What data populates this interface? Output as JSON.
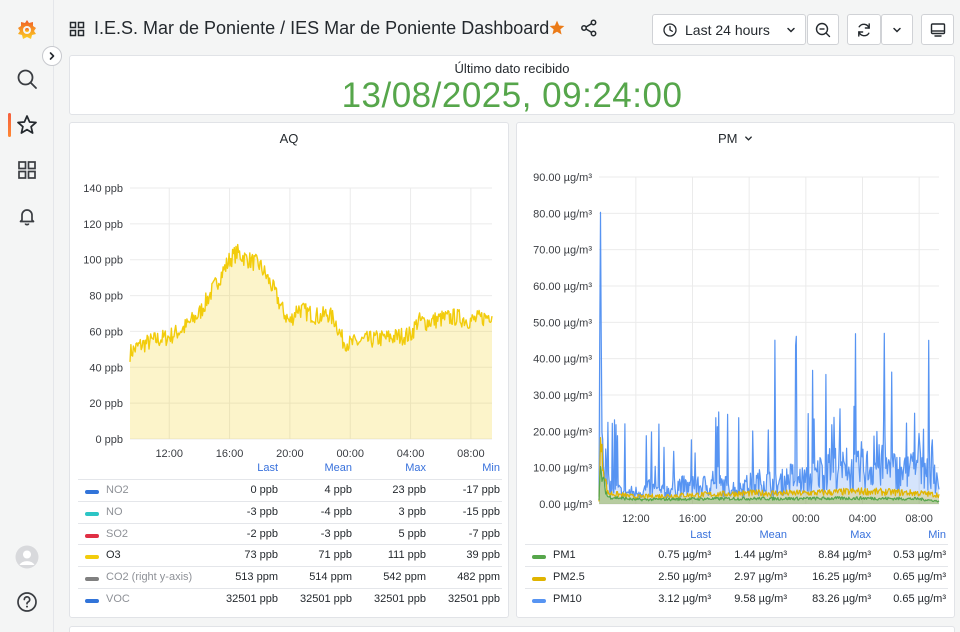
{
  "header": {
    "breadcrumb": "I.E.S. Mar de Poniente  / IES Mar de Poniente Dashboard",
    "time_range": "Last 24 hours"
  },
  "stat": {
    "label": "Último dato recibido",
    "value": "13/08/2025, 09:24:00",
    "color": "#56a64b"
  },
  "aq": {
    "title": "AQ",
    "legend_headers": [
      "Last",
      "Mean",
      "Max",
      "Min"
    ],
    "rows": [
      {
        "name": "NO2",
        "color": "#3274d9",
        "last": "0 ppb",
        "mean": "4 ppb",
        "max": "23 ppb",
        "min": "-17 ppb",
        "hidden": true
      },
      {
        "name": "NO",
        "color": "#2cc5c5",
        "last": "-3 ppb",
        "mean": "-4 ppb",
        "max": "3 ppb",
        "min": "-15 ppb",
        "hidden": true
      },
      {
        "name": "SO2",
        "color": "#e02f44",
        "last": "-2 ppb",
        "mean": "-3 ppb",
        "max": "5 ppb",
        "min": "-7 ppb",
        "hidden": true
      },
      {
        "name": "O3",
        "color": "#f2cc0c",
        "last": "73 ppb",
        "mean": "71 ppb",
        "max": "111 ppb",
        "min": "39 ppb",
        "hidden": false
      },
      {
        "name": "CO2 (right y-axis)",
        "color": "#808080",
        "last": "513 ppm",
        "mean": "514 ppm",
        "max": "542 ppm",
        "min": "482 ppm",
        "hidden": true
      },
      {
        "name": "VOC",
        "color": "#3274d9",
        "last": "32501 ppb",
        "mean": "32501 ppb",
        "max": "32501 ppb",
        "min": "32501 ppb",
        "hidden": true
      }
    ]
  },
  "pm": {
    "title": "PM",
    "legend_headers": [
      "Last",
      "Mean",
      "Max",
      "Min"
    ],
    "rows": [
      {
        "name": "PM1",
        "color": "#56a64b",
        "last": "0.75 µg/m³",
        "mean": "1.44 µg/m³",
        "max": "8.84 µg/m³",
        "min": "0.53 µg/m³"
      },
      {
        "name": "PM2.5",
        "color": "#e0b400",
        "last": "2.50 µg/m³",
        "mean": "2.97 µg/m³",
        "max": "16.25 µg/m³",
        "min": "0.65 µg/m³"
      },
      {
        "name": "PM10",
        "color": "#5794f2",
        "last": "3.12 µg/m³",
        "mean": "9.58 µg/m³",
        "max": "83.26 µg/m³",
        "min": "0.65 µg/m³"
      }
    ]
  },
  "chart_data": [
    {
      "type": "area",
      "title": "AQ",
      "ylim": [
        0,
        140
      ],
      "yticks": [
        "0 ppb",
        "20 ppb",
        "40 ppb",
        "60 ppb",
        "80 ppb",
        "100 ppb",
        "120 ppb",
        "140 ppb"
      ],
      "xticks": [
        "12:00",
        "16:00",
        "20:00",
        "00:00",
        "04:00",
        "08:00"
      ],
      "xtick_hours": [
        12,
        16,
        20,
        24,
        28,
        32
      ],
      "x_range_hours": [
        9.4,
        33.4
      ],
      "grid": true,
      "series": [
        {
          "name": "O3",
          "color": "#f2cc0c",
          "points": [
            [
              9.4,
              48
            ],
            [
              10,
              52
            ],
            [
              11,
              55
            ],
            [
              12,
              57
            ],
            [
              13,
              62
            ],
            [
              14,
              70
            ],
            [
              15,
              85
            ],
            [
              16,
              100
            ],
            [
              16.5,
              104
            ],
            [
              17,
              101
            ],
            [
              18,
              97
            ],
            [
              18.5,
              90
            ],
            [
              19,
              82
            ],
            [
              19.5,
              72
            ],
            [
              20,
              65
            ],
            [
              20.5,
              73
            ],
            [
              21,
              71
            ],
            [
              22,
              68
            ],
            [
              22.5,
              70
            ],
            [
              23,
              66
            ],
            [
              23.5,
              55
            ],
            [
              24,
              53
            ],
            [
              25,
              55
            ],
            [
              26,
              56
            ],
            [
              27,
              57
            ],
            [
              28,
              58
            ],
            [
              28.5,
              66
            ],
            [
              29,
              65
            ],
            [
              30,
              67
            ],
            [
              31,
              68
            ],
            [
              32,
              66
            ],
            [
              33,
              68
            ],
            [
              33.4,
              70
            ]
          ]
        }
      ]
    },
    {
      "type": "area",
      "title": "PM",
      "ylim": [
        0,
        90
      ],
      "yticks": [
        "0.00 µg/m³",
        "10.00 µg/m³",
        "20.00 µg/m³",
        "30.00 µg/m³",
        "40.00 µg/m³",
        "50.00 µg/m³",
        "60.00 µg/m³",
        "70.00 µg/m³",
        "80.00 µg/m³",
        "90.00 µg/m³"
      ],
      "xticks": [
        "12:00",
        "16:00",
        "20:00",
        "00:00",
        "04:00",
        "08:00"
      ],
      "xtick_hours": [
        12,
        16,
        20,
        24,
        28,
        32
      ],
      "x_range_hours": [
        9.4,
        33.4
      ],
      "grid": true,
      "series": [
        {
          "name": "PM10",
          "color": "#5794f2",
          "points": [
            [
              9.4,
              2
            ],
            [
              9.5,
              83
            ],
            [
              9.6,
              20
            ],
            [
              10,
              5
            ],
            [
              11,
              3
            ],
            [
              12,
              3
            ],
            [
              13,
              4
            ],
            [
              14,
              3
            ],
            [
              15,
              5
            ],
            [
              16,
              4
            ],
            [
              17,
              5
            ],
            [
              18,
              5
            ],
            [
              19,
              4
            ],
            [
              20,
              5
            ],
            [
              21,
              6
            ],
            [
              22,
              5
            ],
            [
              23,
              7
            ],
            [
              24,
              6
            ],
            [
              25,
              8
            ],
            [
              26,
              10
            ],
            [
              27,
              8
            ],
            [
              28,
              9
            ],
            [
              29,
              10
            ],
            [
              30,
              9
            ],
            [
              31,
              8
            ],
            [
              32,
              10
            ],
            [
              33,
              9
            ],
            [
              33.4,
              3
            ]
          ]
        },
        {
          "name": "PM2.5",
          "color": "#e0b400",
          "points": [
            [
              9.4,
              1
            ],
            [
              9.5,
              16
            ],
            [
              10,
              3
            ],
            [
              12,
              2
            ],
            [
              16,
              2.5
            ],
            [
              20,
              3
            ],
            [
              24,
              3
            ],
            [
              28,
              3.5
            ],
            [
              32,
              3
            ],
            [
              33.4,
              2.5
            ]
          ]
        },
        {
          "name": "PM1",
          "color": "#56a64b",
          "points": [
            [
              9.4,
              1
            ],
            [
              9.5,
              9
            ],
            [
              10,
              2
            ],
            [
              12,
              1.2
            ],
            [
              16,
              1.4
            ],
            [
              20,
              1.5
            ],
            [
              24,
              1.5
            ],
            [
              28,
              1.6
            ],
            [
              32,
              1.4
            ],
            [
              33.4,
              0.75
            ]
          ]
        }
      ]
    }
  ]
}
